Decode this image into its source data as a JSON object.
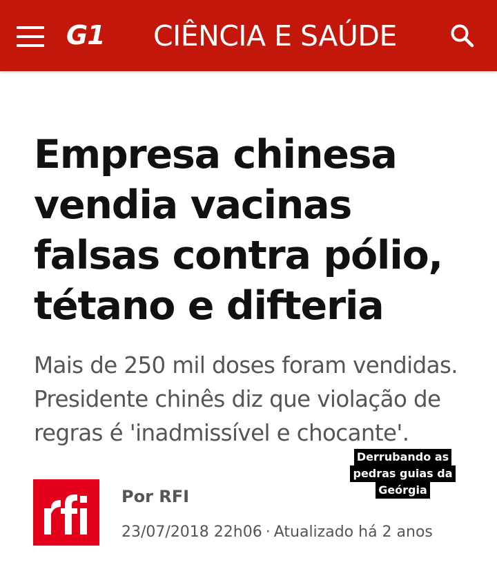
{
  "header": {
    "logo": "G1",
    "section": "CIÊNCIA E SAÚDE",
    "menu_icon": "hamburger-menu-icon",
    "search_icon": "search-icon",
    "bg_color": "#c4170c"
  },
  "article": {
    "headline": "Empresa chinesa vendia vacinas falsas contra pólio, tétano e difteria",
    "subtitle": "Mais de 250 mil doses foram vendidas. Presidente chinês diz que violação de regras é 'inadmissível e chocante'."
  },
  "byline": {
    "source_logo": "rfi",
    "author": "Por RFI",
    "date": "23/07/2018 22h06",
    "separator": "·",
    "updated": "Atualizado há 2 anos",
    "logo_color": "#e3001b"
  },
  "overlay": {
    "lines": [
      "Derrubando as",
      "pedras guias da",
      "Geórgia"
    ]
  }
}
